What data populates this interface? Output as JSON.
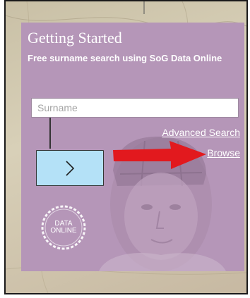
{
  "widget": {
    "title": "Getting Started",
    "subtitle": "Free surname search using SoG Data Online",
    "surname_placeholder": "Surname",
    "surname_value": "",
    "advanced_search_label": "Advanced Search",
    "browse_label": "Browse",
    "badge_line1": "DATA",
    "badge_line2": "ONLINE"
  },
  "icons": {
    "go_button": "chevron-right-icon",
    "arrow": "red-arrow-icon",
    "badge": "data-online-badge"
  },
  "colors": {
    "panel": "#b596b8",
    "go_button": "#b4e1f7",
    "arrow": "#e2191e",
    "text": "#ffffff"
  }
}
